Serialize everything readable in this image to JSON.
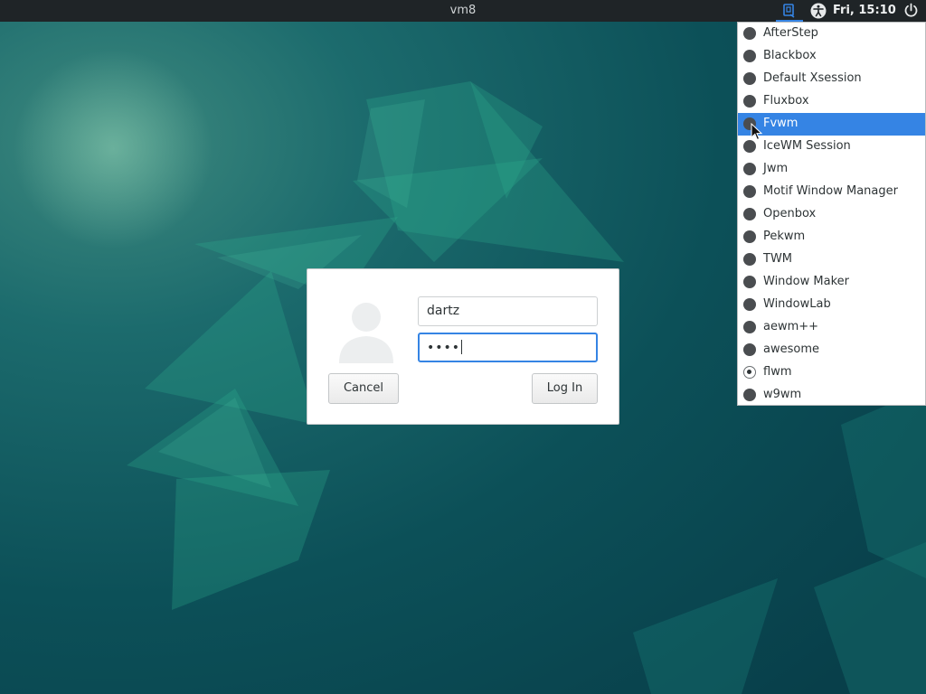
{
  "top_panel": {
    "host_name": "vm8",
    "clock": "Fri, 15:10",
    "icons": [
      "session-icon",
      "accessibility-icon",
      "power-icon"
    ]
  },
  "session_menu": {
    "items": [
      {
        "label": "AfterStep",
        "checked": false,
        "highlighted": false
      },
      {
        "label": "Blackbox",
        "checked": false,
        "highlighted": false
      },
      {
        "label": "Default Xsession",
        "checked": false,
        "highlighted": false
      },
      {
        "label": "Fluxbox",
        "checked": false,
        "highlighted": false
      },
      {
        "label": "Fvwm",
        "checked": false,
        "highlighted": true
      },
      {
        "label": "IceWM Session",
        "checked": false,
        "highlighted": false
      },
      {
        "label": "Jwm",
        "checked": false,
        "highlighted": false
      },
      {
        "label": "Motif Window Manager",
        "checked": false,
        "highlighted": false
      },
      {
        "label": "Openbox",
        "checked": false,
        "highlighted": false
      },
      {
        "label": "Pekwm",
        "checked": false,
        "highlighted": false
      },
      {
        "label": "TWM",
        "checked": false,
        "highlighted": false
      },
      {
        "label": "Window Maker",
        "checked": false,
        "highlighted": false
      },
      {
        "label": "WindowLab",
        "checked": false,
        "highlighted": false
      },
      {
        "label": "aewm++",
        "checked": false,
        "highlighted": false
      },
      {
        "label": "awesome",
        "checked": false,
        "highlighted": false
      },
      {
        "label": "flwm",
        "checked": true,
        "highlighted": false
      },
      {
        "label": "w9wm",
        "checked": false,
        "highlighted": false
      }
    ]
  },
  "login_dialog": {
    "username": "dartz",
    "password_mask": "••••",
    "cancel_label": "Cancel",
    "login_label": "Log In"
  },
  "colors": {
    "accent": "#3584e4",
    "panel_bg": "#1f2427",
    "wallpaper": "#0d4f56"
  }
}
